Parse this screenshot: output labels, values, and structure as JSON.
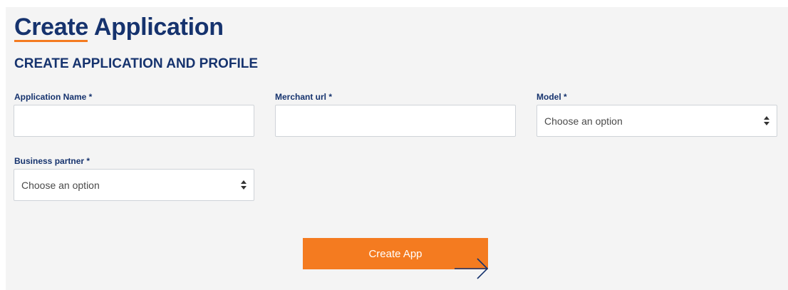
{
  "page": {
    "title": "Create Application",
    "section_title": "CREATE APPLICATION AND PROFILE"
  },
  "form": {
    "application_name": {
      "label": "Application Name *",
      "value": "",
      "placeholder": ""
    },
    "merchant_url": {
      "label": "Merchant url *",
      "value": "",
      "placeholder": ""
    },
    "model": {
      "label": "Model *",
      "selected": "Choose an option"
    },
    "business_partner": {
      "label": "Business partner *",
      "selected": "Choose an option"
    }
  },
  "actions": {
    "create_label": "Create App"
  },
  "colors": {
    "brand_navy": "#16336e",
    "accent_orange": "#f47b20",
    "panel_bg": "#f4f4f4"
  },
  "icons": {
    "select_indicator": "sort-icon",
    "button_arrow": "arrow-right-icon"
  }
}
